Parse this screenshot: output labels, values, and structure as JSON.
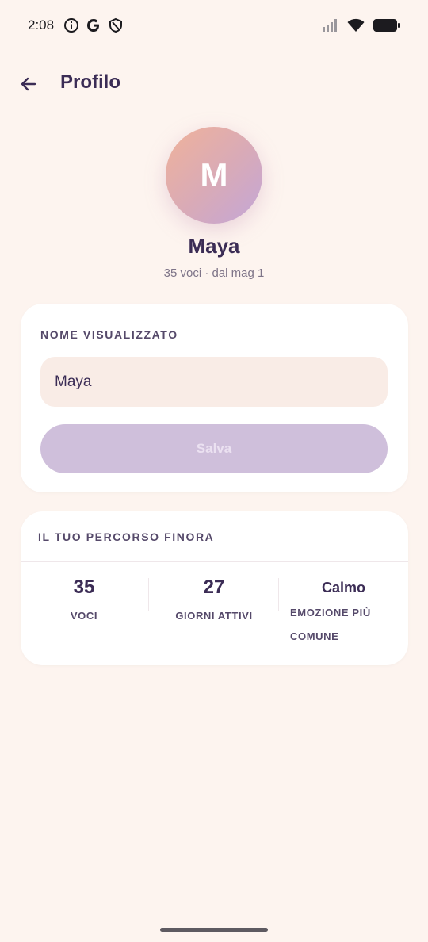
{
  "status_bar": {
    "time": "2:08",
    "icons": [
      "info-icon",
      "google-icon",
      "shield-icon",
      "signal-icon",
      "wifi-icon",
      "battery-icon"
    ]
  },
  "app_bar": {
    "title": "Profilo",
    "back_icon": "arrow-left-icon"
  },
  "profile": {
    "avatar_initial": "M",
    "name": "Maya",
    "meta": "35 voci · dal mag 1"
  },
  "name_card": {
    "label": "NOME VISUALIZZATO",
    "input_value": "Maya",
    "save_label": "Salva"
  },
  "stats_card": {
    "label": "IL TUO PERCORSO FINORA",
    "stats": [
      {
        "value": "35",
        "caption": "VOCI"
      },
      {
        "value": "27",
        "caption": "GIORNI ATTIVI"
      },
      {
        "value": "Calmo",
        "caption": "EMOZIONE PIÙ COMUNE"
      }
    ]
  },
  "colors": {
    "background": "#fdf4ef",
    "primary_text": "#3b2c55",
    "button_disabled": "#cfbfdb",
    "input_bg": "#f9ece6"
  }
}
